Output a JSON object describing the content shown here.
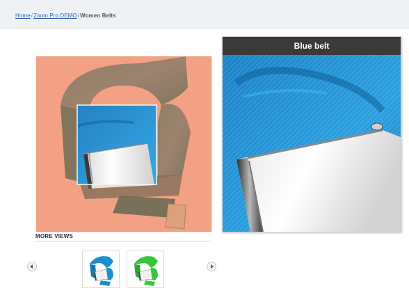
{
  "breadcrumb": {
    "items": [
      {
        "label": "Home",
        "link": true
      },
      {
        "label": "Zoom Pro DEMO",
        "link": true
      },
      {
        "label": "Women Belts",
        "link": false
      }
    ],
    "separator": "/"
  },
  "zoom": {
    "title": "Blue belt"
  },
  "more_views": {
    "heading": "MORE VIEWS",
    "thumbnails": [
      {
        "color": "blue-belt"
      },
      {
        "color": "green-belt"
      }
    ]
  },
  "colors": {
    "background_main": "#f2a184",
    "belt_blue": "#1a8fd0",
    "belt_green": "#39c63b",
    "title_bar": "#3a3a3a",
    "link": "#2a64b6"
  },
  "icons": {
    "prev": "chevron-left-icon",
    "next": "chevron-right-icon"
  }
}
